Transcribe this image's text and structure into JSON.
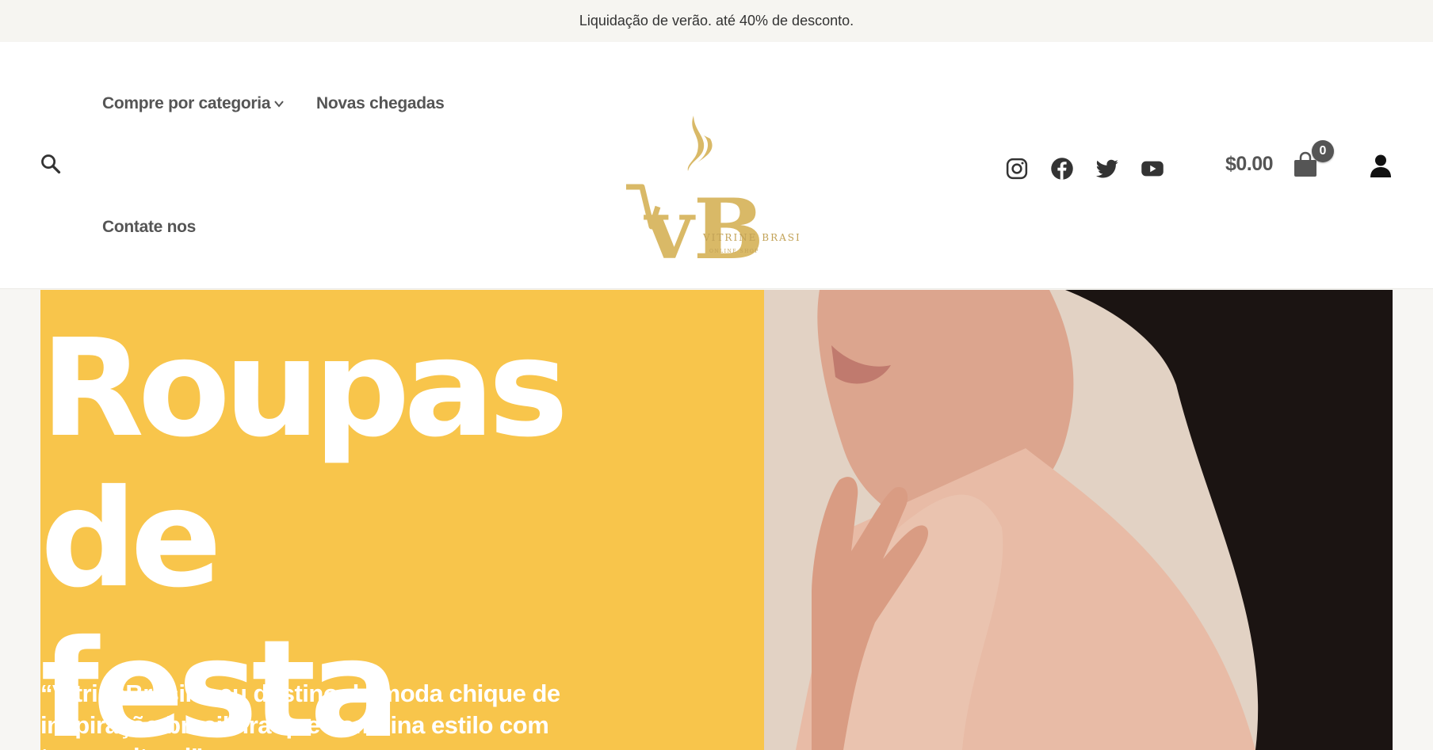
{
  "announcement": "Liquidação de verão. até 40% de desconto.",
  "nav": {
    "items": [
      {
        "label": "Compre por categoria"
      },
      {
        "label": "Novas chegadas"
      },
      {
        "label": "Contate nos"
      }
    ]
  },
  "logo": {
    "monogram": "vB",
    "brand": "VITRINE BRASIL",
    "tagline": "ONLINE SHOP"
  },
  "social": [
    "instagram-icon",
    "facebook-icon",
    "twitter-icon",
    "youtube-icon"
  ],
  "cart": {
    "total": "$0.00",
    "count": "0"
  },
  "hero": {
    "title_line1": "Roupas de",
    "title_line2": "festa",
    "subtitle": "“VitrineBrasil: seu destino de moda chique de inspiração brasileira que combina estilo com tempo ultural”"
  },
  "colors": {
    "hero_yellow": "#f8c54b",
    "logo_gold": "#d9b967",
    "nav_text": "#555555"
  }
}
